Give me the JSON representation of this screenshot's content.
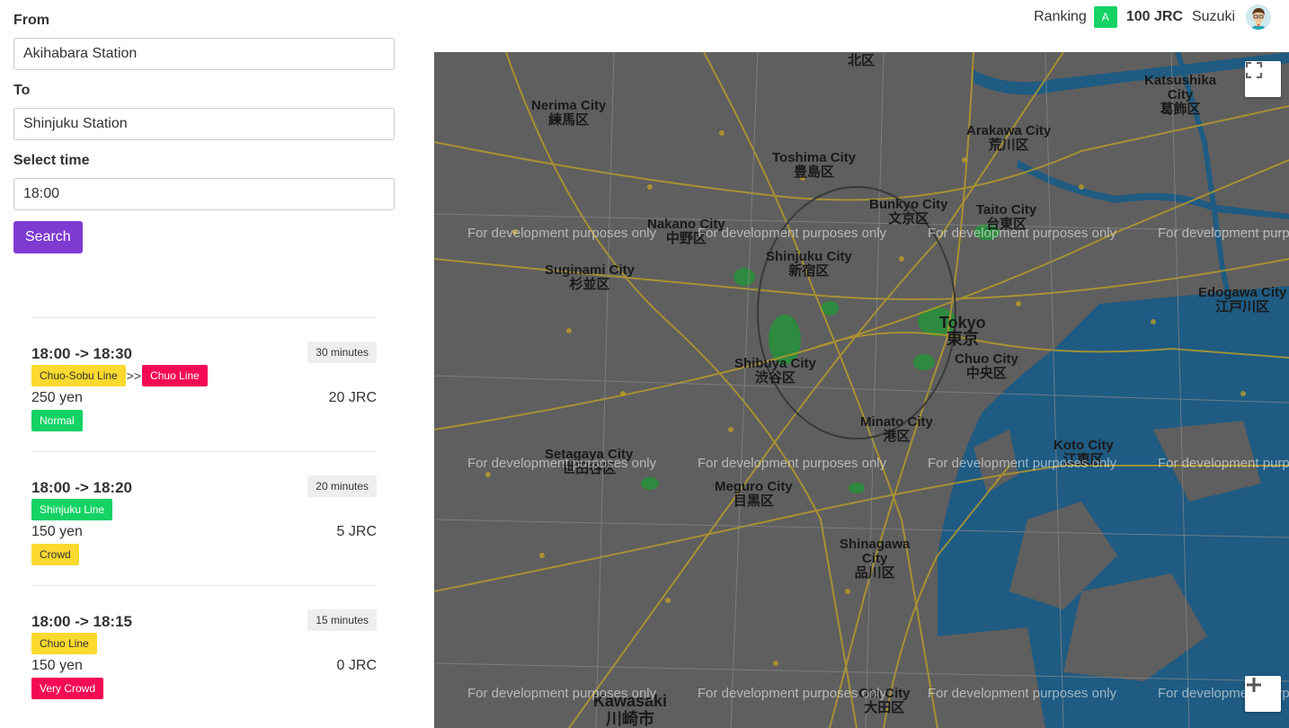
{
  "header": {
    "ranking_label": "Ranking",
    "rank_badge": "A",
    "coins": "100 JRC",
    "user": "Suzuki"
  },
  "form": {
    "from_label": "From",
    "from_value": "Akihabara Station",
    "to_label": "To",
    "to_value": "Shinjuku Station",
    "time_label": "Select time",
    "time_value": "18:00",
    "search_label": "Search"
  },
  "routes": [
    {
      "time": "18:00 -> 18:30",
      "duration": "30 minutes",
      "line1": "Chuo-Sobu Line",
      "separator": ">>",
      "line2": "Chuo Line",
      "price": "250 yen",
      "jrc": "20 JRC",
      "crowd": "Normal"
    },
    {
      "time": "18:00 -> 18:20",
      "duration": "20 minutes",
      "line1": "Shinjuku Line",
      "price": "150 yen",
      "jrc": "5 JRC",
      "crowd": "Crowd"
    },
    {
      "time": "18:00 -> 18:15",
      "duration": "15 minutes",
      "line1": "Chuo Line",
      "price": "150 yen",
      "jrc": "0 JRC",
      "crowd": "Very Crowd"
    }
  ],
  "map": {
    "watermark": "For development purposes only",
    "labels": {
      "nerima": "Nerima City\n練馬区",
      "toshima": "Toshima City\n豊島区",
      "arakawa": "Arakawa City\n荒川区",
      "katsushika": "Katsushika\nCity\n葛飾区",
      "bunkyo": "Bunkyo City\n文京区",
      "taito": "Taito City\n台東区",
      "nakano": "Nakano City\n中野区",
      "shinjuku": "Shinjuku City\n新宿区",
      "suginami": "Suginami City\n杉並区",
      "tokyo": "Tokyo\n東京",
      "chuo": "Chuo City\n中央区",
      "edogawa": "Edogawa City\n江戸川区",
      "shibuya": "Shibuya City\n渋谷区",
      "minato": "Minato City\n港区",
      "koto": "Koto City\n江東区",
      "setagaya": "Setagaya City\n世田谷区",
      "meguro": "Meguro City\n目黒区",
      "shinagawa": "Shinagawa\nCity\n品川区",
      "kawasaki": "Kawasaki\n川崎市",
      "ota": "Ota City\n大田区",
      "kita": "北区"
    }
  },
  "colors": {
    "accent": "#7e3bd2",
    "green": "#14d364",
    "yellow": "#fbd92e",
    "red": "#f50a55"
  }
}
